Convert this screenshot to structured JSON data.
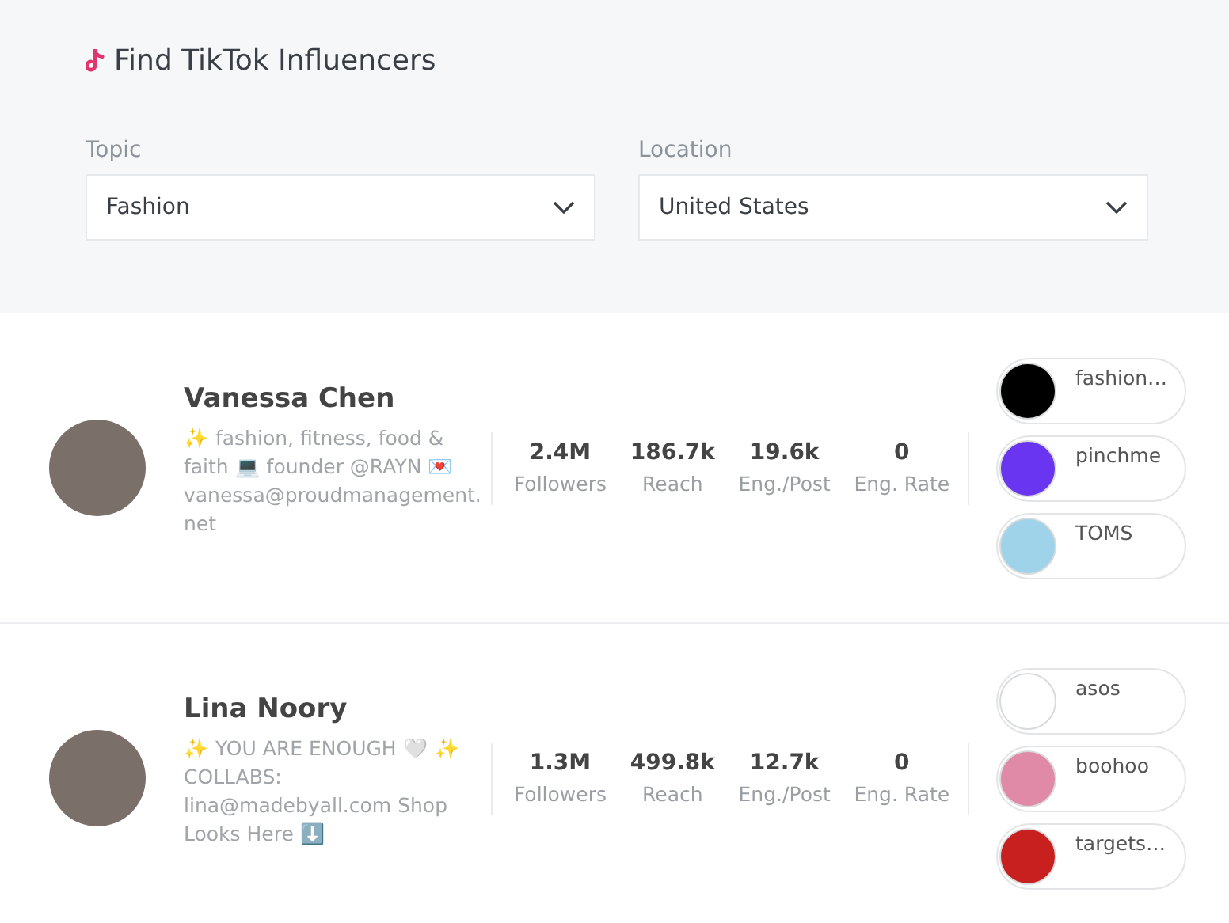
{
  "header": {
    "title": "Find TikTok Influencers"
  },
  "filters": [
    {
      "label": "Topic",
      "value": "Fashion"
    },
    {
      "label": "Location",
      "value": "United States"
    }
  ],
  "influencers": [
    {
      "name": "Vanessa Chen",
      "bio": "✨ fashion, fitness, food & faith 💻 founder @RAYN 💌 vanessa@proudmanagement.net",
      "stats": [
        {
          "value": "2.4M",
          "label": "Followers"
        },
        {
          "value": "186.7k",
          "label": "Reach"
        },
        {
          "value": "19.6k",
          "label": "Eng./Post"
        },
        {
          "value": "0",
          "label": "Eng. Rate"
        }
      ],
      "brands": [
        {
          "name": "fashion…",
          "color": "#000000"
        },
        {
          "name": "pinchme",
          "color": "#6a35f0"
        },
        {
          "name": "TOMS",
          "color": "#9fd3ea"
        }
      ]
    },
    {
      "name": "Lina Noory",
      "bio": "✨ YOU ARE ENOUGH 🤍 ✨ COLLABS: lina@madebyall.com Shop Looks Here ⬇️",
      "stats": [
        {
          "value": "1.3M",
          "label": "Followers"
        },
        {
          "value": "499.8k",
          "label": "Reach"
        },
        {
          "value": "12.7k",
          "label": "Eng./Post"
        },
        {
          "value": "0",
          "label": "Eng. Rate"
        }
      ],
      "brands": [
        {
          "name": "asos",
          "color": "#ffffff"
        },
        {
          "name": "boohoo",
          "color": "#e08aa8"
        },
        {
          "name": "targets…",
          "color": "#c8201e"
        }
      ]
    }
  ]
}
